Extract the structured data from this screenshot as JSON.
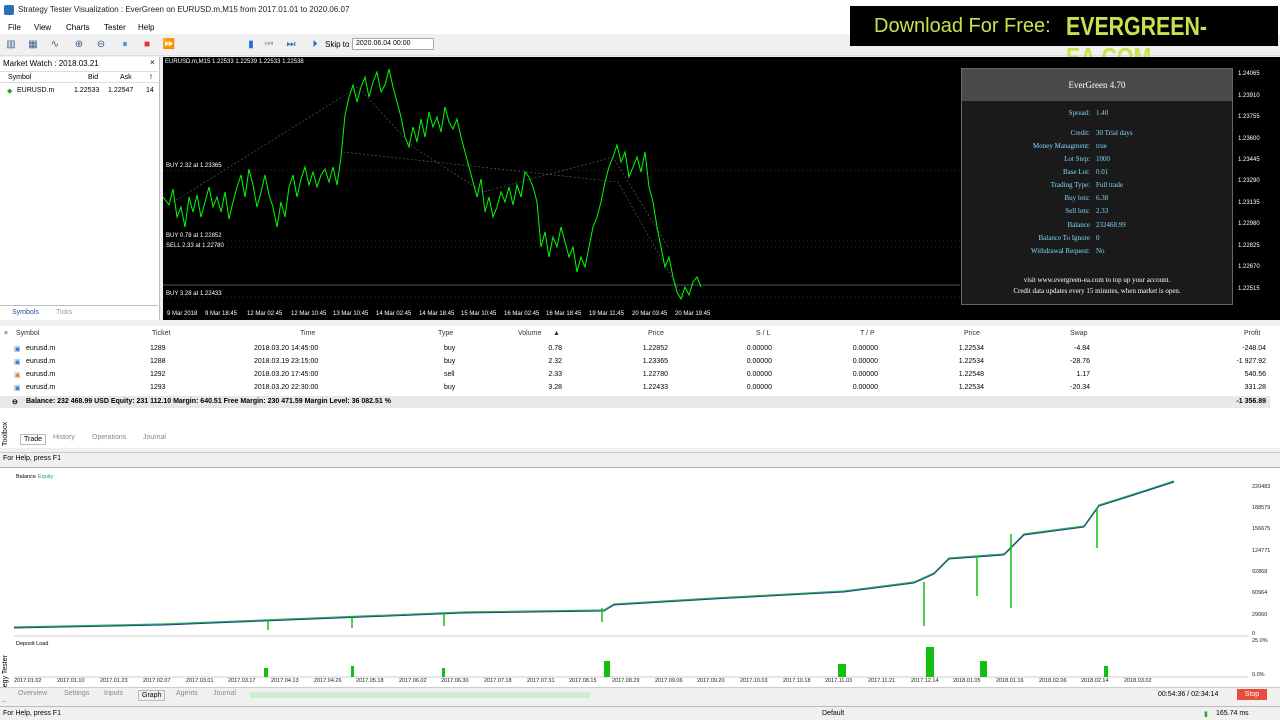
{
  "window": {
    "title": "Strategy Tester Visualization : EverGreen on EURUSD.m,M15 from 2017.01.01 to 2020.06.07"
  },
  "menu": [
    "File",
    "View",
    "Charts",
    "Tester",
    "Help"
  ],
  "banner": {
    "lead": "Download For Free:",
    "domain": "EVERGREEN-EA.COM"
  },
  "toolbar": {
    "skip_label": "Skip to",
    "skip_value": "2020.06.04 00:00"
  },
  "market_watch": {
    "title": "Market Watch : 2018.03.21",
    "headers": [
      "Symbol",
      "Bid",
      "Ask",
      "!"
    ],
    "rows": [
      {
        "symbol": "EURUSD.m",
        "bid": "1.22533",
        "ask": "1.22547",
        "spread": "14"
      }
    ],
    "tabs": [
      "Symbols",
      "Ticks"
    ]
  },
  "chart": {
    "header": "EURUSD.m,M15  1.22533 1.22539 1.22533 1.22538",
    "order_labels": [
      "BUY 2.32 at 1.23365",
      "BUY 0.78 at 1.22852",
      "SELL 2.33 at 1.22780",
      "BUY 3.28 at 1.22433"
    ],
    "x_labels": [
      "9 Mar 2018",
      "9 Mar 18:45",
      "12 Mar 02:45",
      "12 Mar 10:45",
      "13 Mar 10:45",
      "14 Mar 02:45",
      "14 Mar 18:45",
      "15 Mar 10:45",
      "16 Mar 02:45",
      "16 Mar 18:45",
      "19 Mar 11:45",
      "20 Mar 03:45",
      "20 Mar 19:45"
    ],
    "y_labels": [
      "1.24065",
      "1.23910",
      "1.23755",
      "1.23600",
      "1.23445",
      "1.23290",
      "1.23135",
      "1.22980",
      "1.22825",
      "1.22670",
      "1.22515"
    ]
  },
  "ea_panel": {
    "title": "EverGreen 4.70",
    "spread": {
      "label": "Spread:",
      "value": "1.40"
    },
    "rows": [
      {
        "label": "Credit:",
        "value": "30 Trial days"
      },
      {
        "label": "Money Managment:",
        "value": "true"
      },
      {
        "label": "Lot Step:",
        "value": "1000"
      },
      {
        "label": "Base Lot:",
        "value": "0.01"
      },
      {
        "label": "Trading Type:",
        "value": "Full trade"
      },
      {
        "label": "Buy lots:",
        "value": "6.38"
      },
      {
        "label": "Sell lots:",
        "value": "2.33"
      },
      {
        "label": "Balance",
        "value": "232468.99"
      },
      {
        "label": "Balance To Ignore",
        "value": "0"
      },
      {
        "label": "Withdrawal Request:",
        "value": "No"
      }
    ],
    "footer": [
      "visit www.evergreen-ea.com to top up your account.",
      "Credit data updates every 15 minutes, when market is open."
    ]
  },
  "trade": {
    "headers": [
      "Symbol",
      "Ticket",
      "Time",
      "Type",
      "Volume",
      "Price",
      "S / L",
      "T / P",
      "Price",
      "Swap",
      "Profit"
    ],
    "rows": [
      {
        "symbol": "eurusd.m",
        "ticket": "1289",
        "time": "2018.03.20 14:45:00",
        "type": "buy",
        "volume": "0.78",
        "price": "1.22852",
        "sl": "0.00000",
        "tp": "0.00000",
        "cur": "1.22534",
        "swap": "-4.84",
        "profit": "-248.04"
      },
      {
        "symbol": "eurusd.m",
        "ticket": "1288",
        "time": "2018.03.19 23:15:00",
        "type": "buy",
        "volume": "2.32",
        "price": "1.23365",
        "sl": "0.00000",
        "tp": "0.00000",
        "cur": "1.22534",
        "swap": "-28.76",
        "profit": "-1 927.92"
      },
      {
        "symbol": "eurusd.m",
        "ticket": "1292",
        "time": "2018.03.20 17:45:00",
        "type": "sell",
        "volume": "2.33",
        "price": "1.22780",
        "sl": "0.00000",
        "tp": "0.00000",
        "cur": "1.22548",
        "swap": "1.17",
        "profit": "540.56"
      },
      {
        "symbol": "eurusd.m",
        "ticket": "1293",
        "time": "2018.03.20 22:30:00",
        "type": "buy",
        "volume": "3.28",
        "price": "1.22433",
        "sl": "0.00000",
        "tp": "0.00000",
        "cur": "1.22534",
        "swap": "-20.34",
        "profit": "331.28"
      }
    ],
    "balance_line": "Balance: 232 468.99 USD  Equity: 231 112.10  Margin: 640.51  Free Margin: 230 471.59  Margin Level: 36 082.51 %",
    "balance_profit": "-1 356.89",
    "tabs": [
      "Trade",
      "History",
      "Operations",
      "Journal"
    ]
  },
  "toolbox_label": "Toolbox",
  "status_help": "For Help, press F1",
  "graph": {
    "legend_balance": "Balance",
    "legend_equity": "Equity",
    "deposit_label": "Deposit Load",
    "y_labels": [
      "220483",
      "188579",
      "156675",
      "124771",
      "92868",
      "60964",
      "29060",
      "0"
    ],
    "load_labels": [
      "25.0%",
      "0.0%"
    ],
    "x_labels": [
      "2017.01.02",
      "2017.01.10",
      "2017.01.23",
      "2017.02.07",
      "2017.03.01",
      "2017.03.17",
      "2017.04.13",
      "2017.04.26",
      "2017.05.18",
      "2017.06.02",
      "2017.06.30",
      "2017.07.18",
      "2017.07.31",
      "2017.08.15",
      "2017.08.29",
      "2017.09.06",
      "2017.09.20",
      "2017.10.03",
      "2017.10.18",
      "2017.11.03",
      "2017.11.21",
      "2017.12.14",
      "2018.01.05",
      "2018.01.16",
      "2018.02.06",
      "2018.02.14",
      "2018.03.02"
    ],
    "tabs": [
      "Overview",
      "Settings",
      "Inputs",
      "Graph",
      "Agents",
      "Journal"
    ],
    "timer": "00:54:36 / 02:34:14",
    "stop": "Stop"
  },
  "status_bottom": {
    "help": "For Help, press F1",
    "profile": "Default",
    "net": "165.74 ms"
  }
}
